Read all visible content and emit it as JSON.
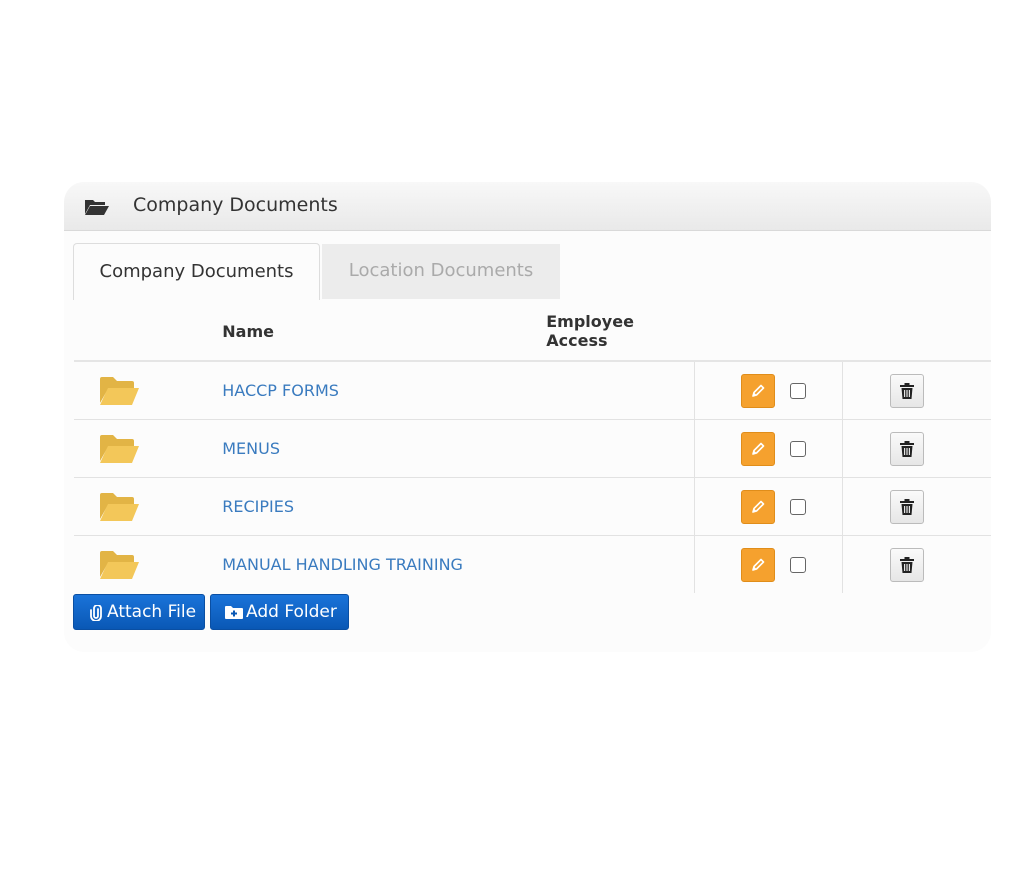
{
  "panel": {
    "title": "Company Documents",
    "icon": "folder-open-icon"
  },
  "tabs": [
    {
      "label": "Company Documents",
      "active": true
    },
    {
      "label": "Location Documents",
      "active": false
    }
  ],
  "table": {
    "columns": {
      "name": "Name",
      "employee_access": "Employee Access"
    },
    "rows": [
      {
        "name": "HACCP FORMS",
        "employee_access": false
      },
      {
        "name": "MENUS",
        "employee_access": false
      },
      {
        "name": "RECIPIES",
        "employee_access": false
      },
      {
        "name": "MANUAL HANDLING TRAINING",
        "employee_access": false
      }
    ]
  },
  "actions": {
    "attach_label": "Attach File",
    "add_folder_label": "Add Folder"
  },
  "colors": {
    "link": "#3a7bbf",
    "folder": "#f3c759",
    "edit": "#f5a12e",
    "primary": "#0a64c8"
  }
}
